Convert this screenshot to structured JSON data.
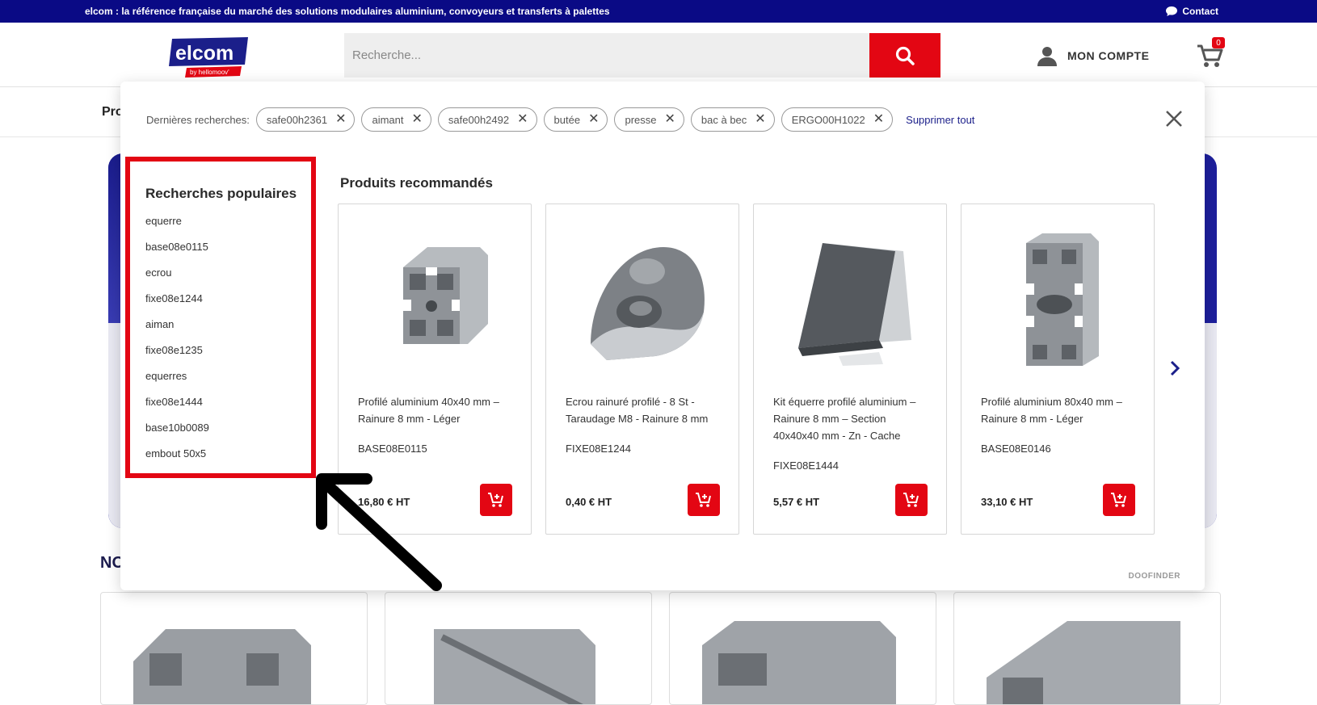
{
  "topbar": {
    "message": "elcom : la référence française du marché des solutions modulaires aluminium, convoyeurs et transferts à palettes",
    "contact": "Contact"
  },
  "header": {
    "logo_text": "elcom",
    "logo_sub": "by hellomoov'",
    "search_placeholder": "Recherche...",
    "account_label": "MON COMPTE",
    "cart_count": "0"
  },
  "background": {
    "nav_text": "Pro",
    "section_heading": "NO"
  },
  "dropdown": {
    "recent_label": "Dernières recherches:",
    "recent_searches": [
      "safe00h2361",
      "aimant",
      "safe00h2492",
      "butée",
      "presse",
      "bac à bec",
      "ERGO00H1022"
    ],
    "clear_all": "Supprimer tout",
    "popular_title": "Recherches populaires",
    "popular_searches": [
      "equerre",
      "base08e0115",
      "ecrou",
      "fixe08e1244",
      "aiman",
      "fixe08e1235",
      "equerres",
      "fixe08e1444",
      "base10b0089",
      "embout 50x5"
    ],
    "recommended_title": "Produits recommandés",
    "products": [
      {
        "name": "Profilé aluminium 40x40 mm – Rainure 8 mm - Léger",
        "ref": "BASE08E0115",
        "price": "16,80 € HT",
        "image": "profile-40x40"
      },
      {
        "name": "Ecrou rainuré profilé - 8 St - Taraudage M8 - Rainure 8 mm",
        "ref": "FIXE08E1244",
        "price": "0,40 € HT",
        "image": "groove-nut"
      },
      {
        "name": "Kit équerre profilé aluminium – Rainure 8 mm – Section 40x40x40 mm - Zn - Cache",
        "ref": "FIXE08E1444",
        "price": "5,57 € HT",
        "image": "angle-bracket"
      },
      {
        "name": "Profilé aluminium 80x40 mm – Rainure 8 mm - Léger",
        "ref": "BASE08E0146",
        "price": "33,10 € HT",
        "image": "profile-80x40"
      }
    ],
    "powered_by": "DOOFINDER"
  },
  "colors": {
    "brand_blue": "#0a0a85",
    "brand_red": "#e30613"
  }
}
